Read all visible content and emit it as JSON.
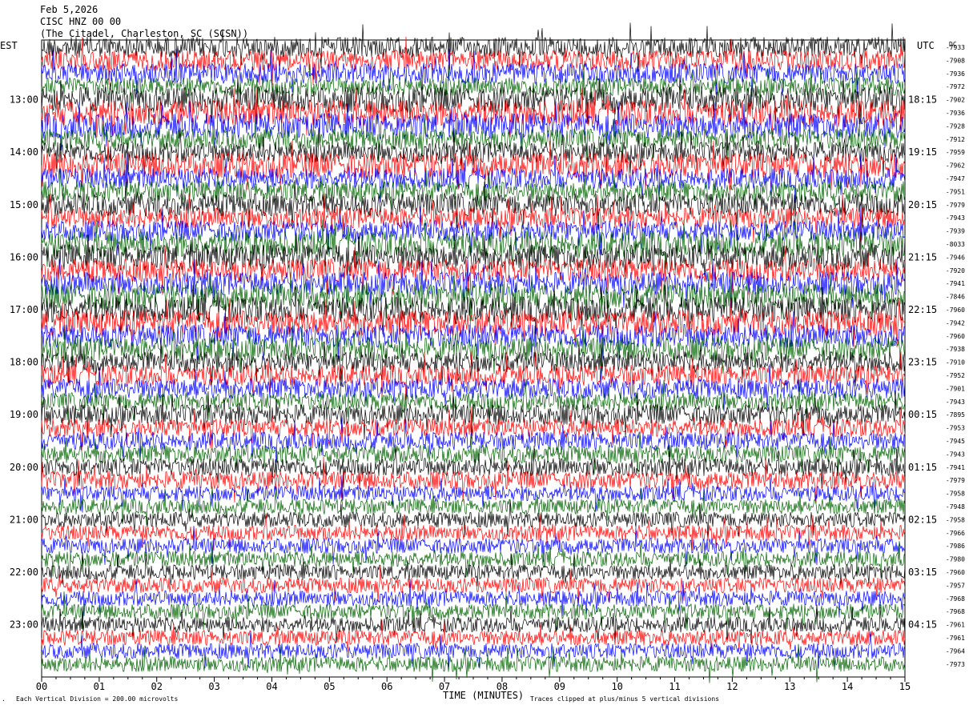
{
  "header": {
    "date": "Feb 5,2026",
    "station": "CISC HNZ 00 00",
    "location": "(The Citadel, Charleston, SC (SCSN))"
  },
  "left_timezone": "EST",
  "right_timezone": "UTC",
  "dc_label": "DC",
  "footer": {
    "scale_note": "Each Vertical Division =  200.00 microvolts",
    "clip_note": "Traces clipped at plus/minus 5 vertical divisions",
    "corner_mark": "."
  },
  "colors": {
    "trace_cycle": [
      "#000000",
      "#ff0000",
      "#0000ff",
      "#006400"
    ]
  },
  "chart_data": {
    "type": "line",
    "subtype": "helicorder",
    "xlabel": "TIME (MINUTES)",
    "xlim": [
      0,
      15
    ],
    "x_ticks": [
      "00",
      "01",
      "02",
      "03",
      "04",
      "05",
      "06",
      "07",
      "08",
      "09",
      "10",
      "11",
      "12",
      "13",
      "14",
      "15"
    ],
    "minutes_per_line": 15,
    "left_hour_labels": [
      "13:00",
      "14:00",
      "15:00",
      "16:00",
      "17:00",
      "18:00",
      "19:00",
      "20:00",
      "21:00",
      "22:00",
      "23:00"
    ],
    "right_hour_labels": [
      "18:15",
      "19:15",
      "20:15",
      "21:15",
      "22:15",
      "23:15",
      "00:15",
      "01:15",
      "02:15",
      "03:15",
      "04:15"
    ],
    "first_labeled_line": 4,
    "dc_offsets": [
      -7933,
      -7908,
      -7936,
      -7972,
      -7902,
      -7936,
      -7928,
      -7912,
      -7959,
      -7962,
      -7947,
      -7951,
      -7979,
      -7943,
      -7939,
      -8033,
      -7946,
      -7920,
      -7941,
      -7846,
      -7960,
      -7942,
      -7960,
      -7938,
      -7910,
      -7952,
      -7901,
      -7943,
      -7895,
      -7953,
      -7945,
      -7943,
      -7941,
      -7979,
      -7958,
      -7948,
      -7958,
      -7966,
      -7986,
      -7980,
      -7960,
      -7957,
      -7968,
      -7968,
      -7961,
      -7961,
      -7964,
      -7973
    ],
    "line_amplitude_divisions": [
      4,
      4,
      4,
      3.5,
      5,
      5,
      5,
      4,
      4,
      5,
      4,
      4,
      4.5,
      4,
      4,
      5,
      5,
      4.5,
      4.5,
      5,
      5,
      5,
      4.5,
      4.5,
      4,
      4,
      4,
      3.5,
      4,
      3.5,
      3.5,
      3.5,
      3.5,
      3.5,
      3,
      3,
      3,
      3,
      3,
      3,
      3,
      3,
      3,
      3,
      3,
      3,
      3,
      3
    ],
    "trace_color_cycle": [
      "black",
      "red",
      "blue",
      "green"
    ]
  }
}
